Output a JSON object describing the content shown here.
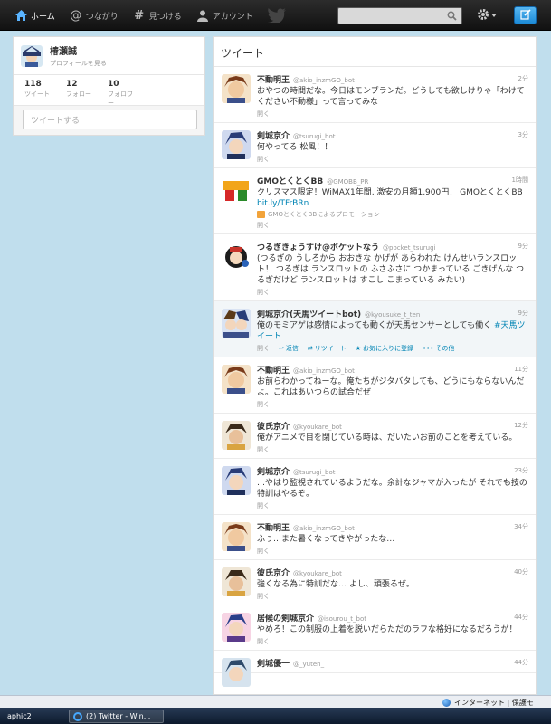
{
  "nav": {
    "home": "ホーム",
    "connect": "つながり",
    "discover": "見つける",
    "account": "アカウント"
  },
  "search": {
    "placeholder": ""
  },
  "dashboard": {
    "name": "椿瀬誠",
    "view_profile": "プロフィールを見る",
    "tweets_count": "118",
    "tweets_label": "ツイート",
    "following_count": "12",
    "following_label": "フォロー",
    "followers_count": "10",
    "followers_label": "フォロワー",
    "compose_placeholder": "ツイートする"
  },
  "stream": {
    "title": "ツイート",
    "tweets": [
      {
        "name": "不動明王",
        "handle": "@akio_inzmGO_bot",
        "time": "2分",
        "text": "おやつの時間だな。今日はモンブランだ。どうしても欲しけりゃ「わけてください不動様」って言ってみな",
        "open": "開く"
      },
      {
        "name": "剣城京介",
        "handle": "@tsurugi_bot",
        "time": "3分",
        "text": "何やってる 松風！！",
        "open": "開く"
      },
      {
        "name": "GMOとくとくBB",
        "handle": "@GMOBB_PR",
        "time": "1時間",
        "text": "クリスマス限定！WiMAX1年間, 激安の月額1,900円！ GMOとくとくBB ",
        "link": "bit.ly/TFrBRn",
        "promo": "GMOとくとくBBによるプロモーション",
        "open": "開く"
      },
      {
        "name": "つるぎきょうすけ@ポケットなう",
        "handle": "@pocket_tsurugi",
        "time": "9分",
        "text": "(つるぎの うしろから おおきな かげが あらわれた けんせいランスロット！ つるぎは ランスロットの ふさふさに つかまっている ごきげんな つるぎだけど ランスロットは すこし こまっている みたい)",
        "open": "開く"
      },
      {
        "name": "剣城京介(天馬ツイートbot)",
        "handle": "@kyousuke_t_ten",
        "time": "9分",
        "text": "俺のモミアゲは感情によっても動くが天馬センサーとしても働く ",
        "link": "#天馬ツイート",
        "actions": [
          "開く",
          "返信",
          "リツイート",
          "お気に入りに登録",
          "その他"
        ]
      },
      {
        "name": "不動明王",
        "handle": "@akio_inzmGO_bot",
        "time": "11分",
        "text": "お前らわかってねーな。俺たちがジタバタしても、どうにもならないんだよ。これはあいつらの試合だぜ",
        "open": "開く"
      },
      {
        "name": "彼氏京介",
        "handle": "@kyoukare_bot",
        "time": "12分",
        "text": "俺がアニメで目を閉じている時は、だいたいお前のことを考えている。",
        "open": "開く"
      },
      {
        "name": "剣城京介",
        "handle": "@tsurugi_bot",
        "time": "23分",
        "text": "…やはり監視されているようだな。余計なジャマが入ったが それでも技の特訓はやるぞ。",
        "open": "開く"
      },
      {
        "name": "不動明王",
        "handle": "@akio_inzmGO_bot",
        "time": "34分",
        "text": "ふぅ…また暑くなってきやがったな…",
        "open": "開く"
      },
      {
        "name": "彼氏京介",
        "handle": "@kyoukare_bot",
        "time": "40分",
        "text": "強くなる為に特訓だな… よし、頑張るぜ。",
        "open": "開く"
      },
      {
        "name": "居候の剣城京介",
        "handle": "@isourou_t_bot",
        "time": "44分",
        "text": "やめろ！この制服の上着を脱いだらただのラフな格好になるだろうが！",
        "open": "開く"
      },
      {
        "name": "剣城優一",
        "handle": "@_yuten_",
        "time": "44分",
        "text": "",
        "open": ""
      }
    ]
  },
  "statusbar": {
    "zone": "インターネット | 保護モ"
  },
  "taskbar": {
    "task1": "aphic2",
    "task2": "(2) Twitter - Win..."
  },
  "colors": {
    "accent": "#0084b4",
    "topbar": "#1c1c1c",
    "background": "#c0deed"
  }
}
